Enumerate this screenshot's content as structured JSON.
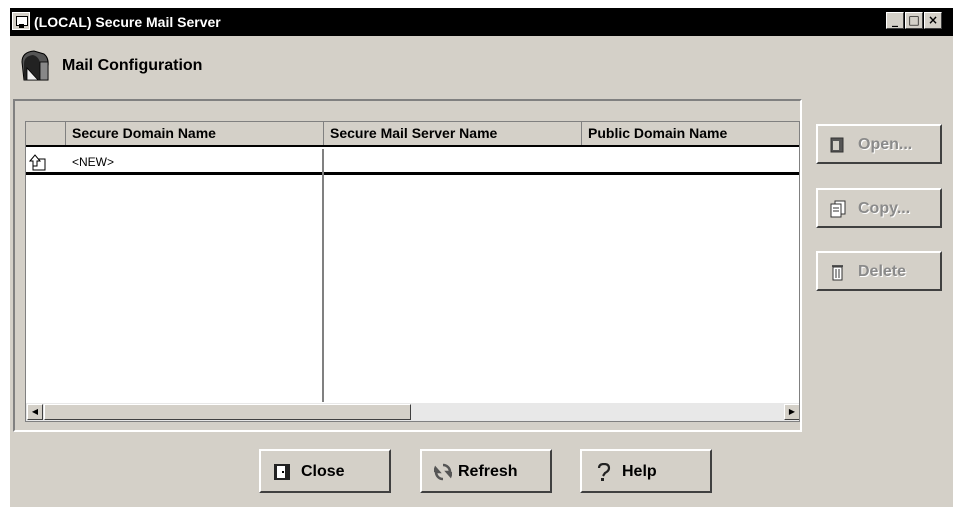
{
  "window": {
    "title": "(LOCAL) Secure Mail Server",
    "controls": {
      "minimize": "_",
      "maximize": "□",
      "close": "×"
    }
  },
  "header": {
    "title": "Mail Configuration",
    "icon": "mailbox-icon"
  },
  "table": {
    "columns": [
      "Secure Domain Name",
      "Secure Mail Server Name",
      "Public Domain Name"
    ],
    "rows": [
      {
        "icon": "new-record-icon",
        "values": [
          "<NEW>",
          "",
          ""
        ]
      }
    ]
  },
  "side_buttons": {
    "open": {
      "label": "Open...",
      "icon": "open-icon",
      "enabled": false
    },
    "copy": {
      "label": "Copy...",
      "icon": "copy-icon",
      "enabled": false
    },
    "delete": {
      "label": "Delete",
      "icon": "trash-icon",
      "enabled": false
    }
  },
  "bottom_buttons": {
    "close": {
      "label": "Close",
      "icon": "close-door-icon"
    },
    "refresh": {
      "label": "Refresh",
      "icon": "refresh-icon"
    },
    "help": {
      "label": "Help",
      "icon": "question-icon"
    }
  },
  "colors": {
    "face": "#d4d0c8",
    "titlebar": "#000000",
    "disabled_text": "#8a8a8a"
  }
}
